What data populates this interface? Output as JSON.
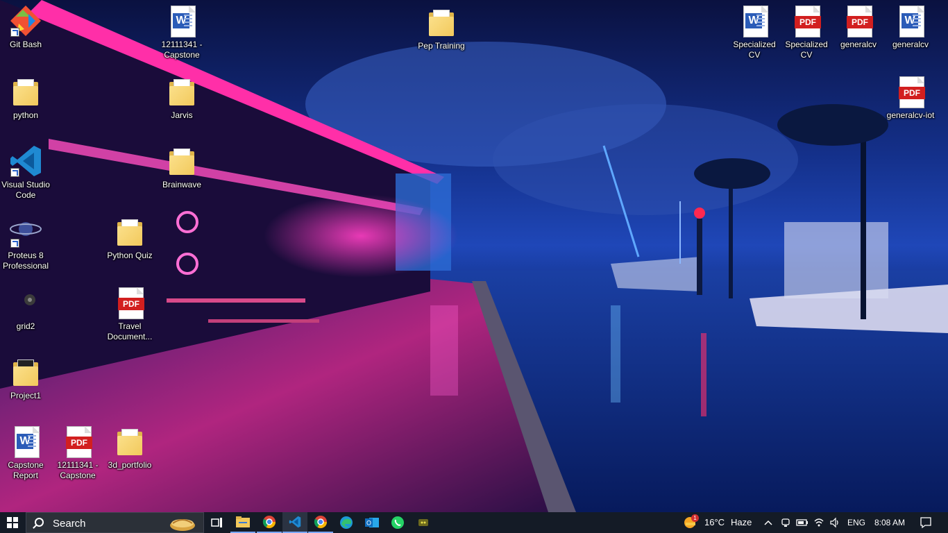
{
  "desktop": {
    "icons": [
      {
        "label": "Git Bash",
        "icon": "git-bash-icon",
        "type": "app"
      },
      {
        "label": "python",
        "icon": "folder-icon",
        "type": "folder"
      },
      {
        "label": "Visual Studio Code",
        "icon": "vscode-icon",
        "type": "app"
      },
      {
        "label": "Proteus 8 Professional",
        "icon": "proteus-icon",
        "type": "app"
      },
      {
        "label": "grid2",
        "icon": "grid2-icon",
        "type": "app"
      },
      {
        "label": "Project1",
        "icon": "folder-icon",
        "type": "folder"
      },
      {
        "label": "Capstone Report",
        "icon": "word-doc-icon",
        "type": "word"
      },
      {
        "label": "12111341 - Capstone",
        "icon": "pdf-icon",
        "type": "pdf"
      },
      {
        "label": "3d_portfolio",
        "icon": "folder-icon",
        "type": "folder"
      },
      {
        "label": "12111341 - Capstone",
        "icon": "word-doc-icon",
        "type": "word"
      },
      {
        "label": "Jarvis",
        "icon": "folder-icon",
        "type": "folder"
      },
      {
        "label": "Brainwave",
        "icon": "folder-icon",
        "type": "folder"
      },
      {
        "label": "Python Quiz",
        "icon": "folder-icon",
        "type": "folder"
      },
      {
        "label": "Travel Document...",
        "icon": "pdf-icon",
        "type": "pdf"
      },
      {
        "label": "Pep Training",
        "icon": "folder-icon",
        "type": "folder"
      },
      {
        "label": "Specialized CV",
        "icon": "word-doc-icon",
        "type": "word"
      },
      {
        "label": "Specialized CV",
        "icon": "pdf-icon",
        "type": "pdf"
      },
      {
        "label": "generalcv",
        "icon": "pdf-icon",
        "type": "pdf"
      },
      {
        "label": "generalcv",
        "icon": "word-doc-icon",
        "type": "word"
      },
      {
        "label": "generalcv-iot",
        "icon": "pdf-icon",
        "type": "pdf"
      }
    ],
    "word_badge": "W",
    "pdf_badge": "PDF"
  },
  "taskbar": {
    "search_placeholder": "Search",
    "pinned_apps": [
      "task-view-icon",
      "file-explorer-icon",
      "chrome-icon",
      "vscode-icon",
      "chrome-icon",
      "edge-icon",
      "outlook-icon",
      "whatsapp-icon",
      "app-icon"
    ],
    "weather_temp": "16°C",
    "weather_condition": "Haze",
    "weather_badge": "1",
    "language": "ENG",
    "time": "8:08 AM"
  },
  "colors": {
    "taskbar_bg": "#141b26",
    "word_blue": "#2b5cb8",
    "pdf_red": "#d21f1f",
    "folder_yellow": "#f2c95c"
  }
}
